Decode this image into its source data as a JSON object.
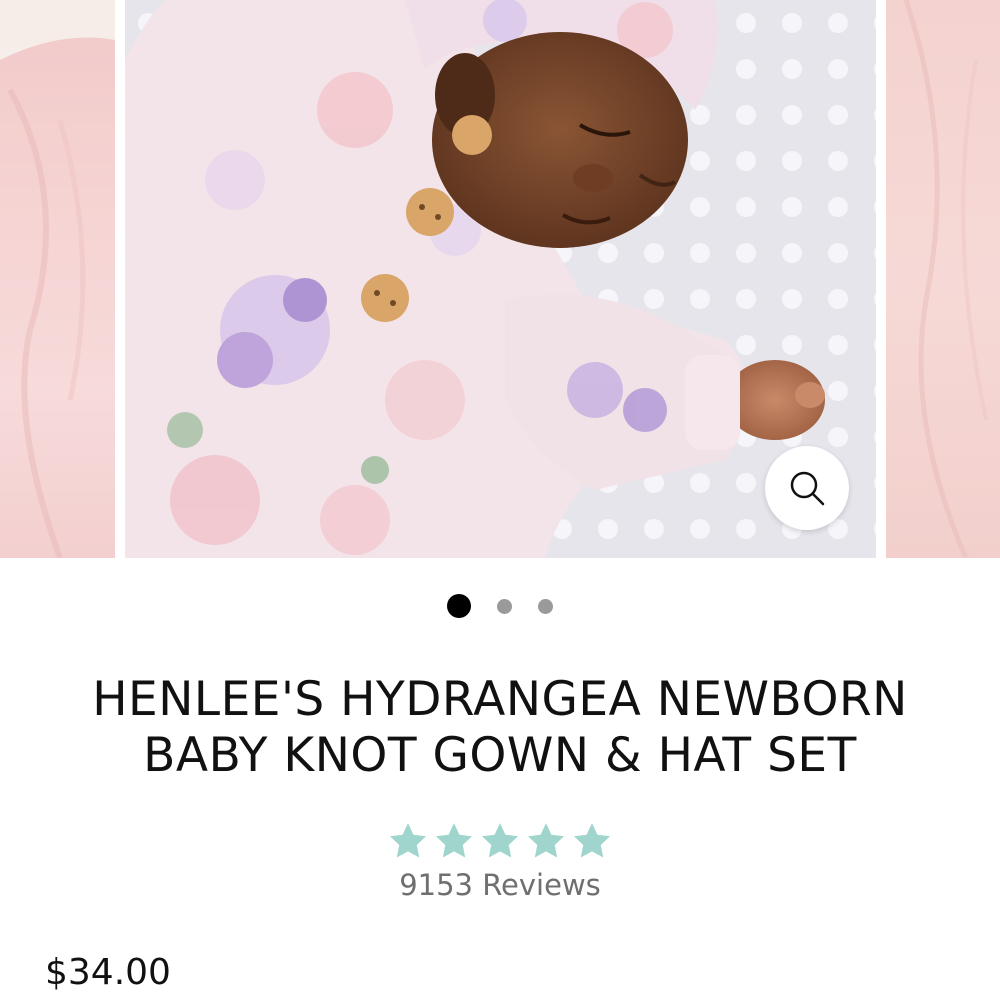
{
  "product": {
    "title_line_1": "HENLEE'S HYDRANGEA NEWBORN",
    "title_line_2": "BABY KNOT GOWN & HAT SET",
    "rating": {
      "stars_filled": 5,
      "stars_total": 5,
      "star_color": "#9fd5cc",
      "reviews_label": "9153 Reviews"
    },
    "price": "$34.00"
  },
  "carousel": {
    "slide_count": 3,
    "active_index": 0,
    "main_image": "sleeping newborn in floral knot gown and hat on white minky blanket",
    "zoom_icon": "search-icon"
  },
  "colors": {
    "dot_active": "#000000",
    "dot_inactive": "#9a9a9a",
    "side_slide_pink": "#f4d3d1"
  }
}
